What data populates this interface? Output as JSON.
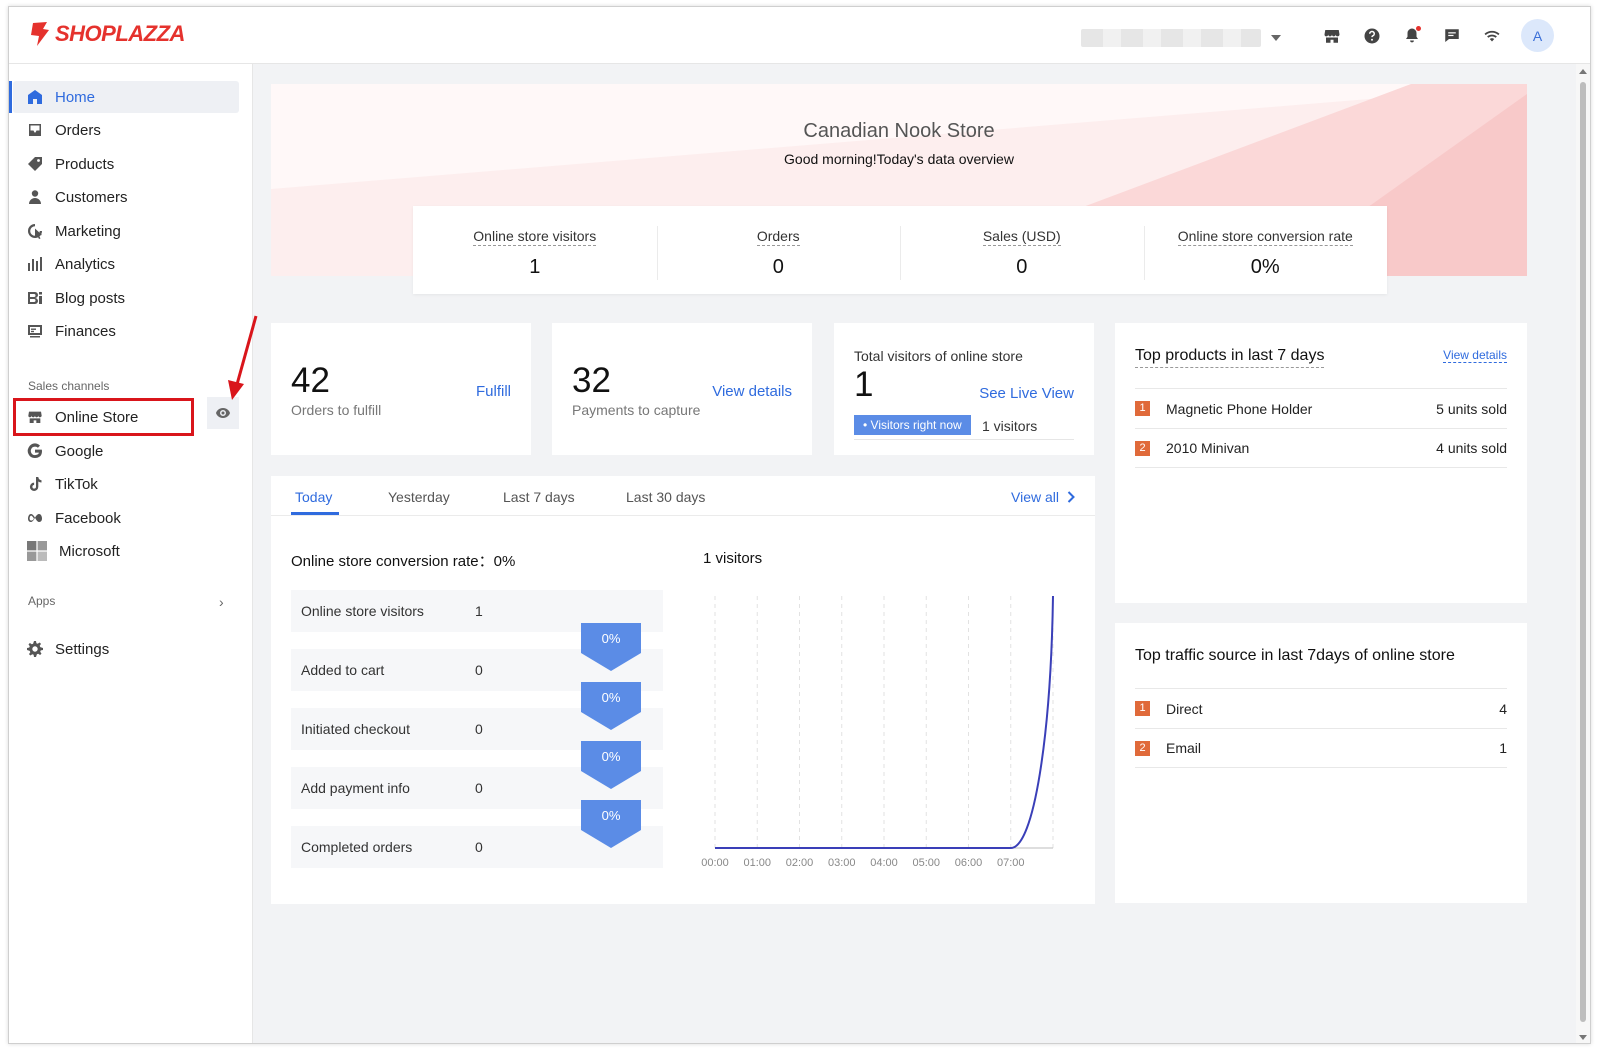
{
  "brand": {
    "name": "SHOPLAZZA",
    "color": "#e5322d"
  },
  "topbar": {
    "icons": [
      "store-icon",
      "help-icon",
      "bell-icon",
      "chat-icon",
      "wifi-icon"
    ],
    "avatar_initial": "A"
  },
  "sidebar": {
    "items": [
      {
        "label": "Home",
        "icon": "home-icon",
        "active": true
      },
      {
        "label": "Orders",
        "icon": "orders-icon"
      },
      {
        "label": "Products",
        "icon": "tag-icon"
      },
      {
        "label": "Customers",
        "icon": "person-icon"
      },
      {
        "label": "Marketing",
        "icon": "marketing-icon"
      },
      {
        "label": "Analytics",
        "icon": "bar-chart-icon"
      },
      {
        "label": "Blog posts",
        "icon": "blog-icon"
      },
      {
        "label": "Finances",
        "icon": "finance-icon"
      }
    ],
    "sales_channels_label": "Sales channels",
    "channels": [
      {
        "label": "Online Store",
        "icon": "store-icon"
      },
      {
        "label": "Google",
        "icon": "google-icon"
      },
      {
        "label": "TikTok",
        "icon": "tiktok-icon"
      },
      {
        "label": "Facebook",
        "icon": "meta-icon"
      },
      {
        "label": "Microsoft",
        "icon": "microsoft-icon"
      }
    ],
    "apps_label": "Apps",
    "settings_label": "Settings"
  },
  "hero": {
    "store_name": "Canadian Nook Store",
    "greeting": "Good morning!Today's data overview"
  },
  "stats": [
    {
      "label": "Online store visitors",
      "value": "1"
    },
    {
      "label": "Orders",
      "value": "0"
    },
    {
      "label": "Sales (USD)",
      "value": "0"
    },
    {
      "label": "Online store conversion rate",
      "value": "0%"
    }
  ],
  "kpis": {
    "fulfill": {
      "number": "42",
      "label": "Orders to fulfill",
      "link": "Fulfill"
    },
    "payments": {
      "number": "32",
      "label": "Payments to capture",
      "link": "View details"
    },
    "visitors": {
      "title": "Total visitors of online store",
      "number": "1",
      "link": "See Live View",
      "badge": "• Visitors right now",
      "count": "1 visitors"
    }
  },
  "tabs": {
    "items": [
      "Today",
      "Yesterday",
      "Last 7 days",
      "Last 30 days"
    ],
    "active": "Today",
    "view_all": "View all"
  },
  "conversion": {
    "title": "Online store conversion rate：0%",
    "funnel": [
      {
        "label": "Online store visitors",
        "value": "1"
      },
      {
        "label": "Added to cart",
        "value": "0"
      },
      {
        "label": "Initiated checkout",
        "value": "0"
      },
      {
        "label": "Add payment info",
        "value": "0"
      },
      {
        "label": "Completed orders",
        "value": "0"
      }
    ],
    "rates": [
      "0%",
      "0%",
      "0%",
      "0%"
    ]
  },
  "visitors_chart_title": "1 visitors",
  "chart_data": {
    "type": "line",
    "title": "1 visitors",
    "x": [
      "00:00",
      "01:00",
      "02:00",
      "03:00",
      "04:00",
      "05:00",
      "06:00",
      "07:00",
      "08:00"
    ],
    "tick_labels": [
      "00:00",
      "01:00",
      "02:00",
      "03:00",
      "04:00",
      "05:00",
      "06:00",
      "07:00"
    ],
    "series": [
      {
        "values": [
          0,
          0,
          0,
          0,
          0,
          0,
          0,
          0,
          1
        ]
      }
    ],
    "ylim": [
      0,
      1
    ],
    "color": "#3a3fb8",
    "grid": "vertical-dashed"
  },
  "top_products": {
    "title": "Top products in last 7 days",
    "link": "View details",
    "items": [
      {
        "rank": "1",
        "name": "Magnetic Phone Holder",
        "value": "5 units sold"
      },
      {
        "rank": "2",
        "name": "2010 Minivan",
        "value": "4 units sold"
      }
    ]
  },
  "top_traffic": {
    "title": "Top traffic source in last 7days of online store",
    "items": [
      {
        "rank": "1",
        "name": "Direct",
        "value": "4"
      },
      {
        "rank": "2",
        "name": "Email",
        "value": "1"
      }
    ]
  },
  "colors": {
    "accent": "#2f6bde",
    "highlight": "#d9151b",
    "rank": "#e06a3a",
    "funnel_badge": "#5b8ce6"
  }
}
